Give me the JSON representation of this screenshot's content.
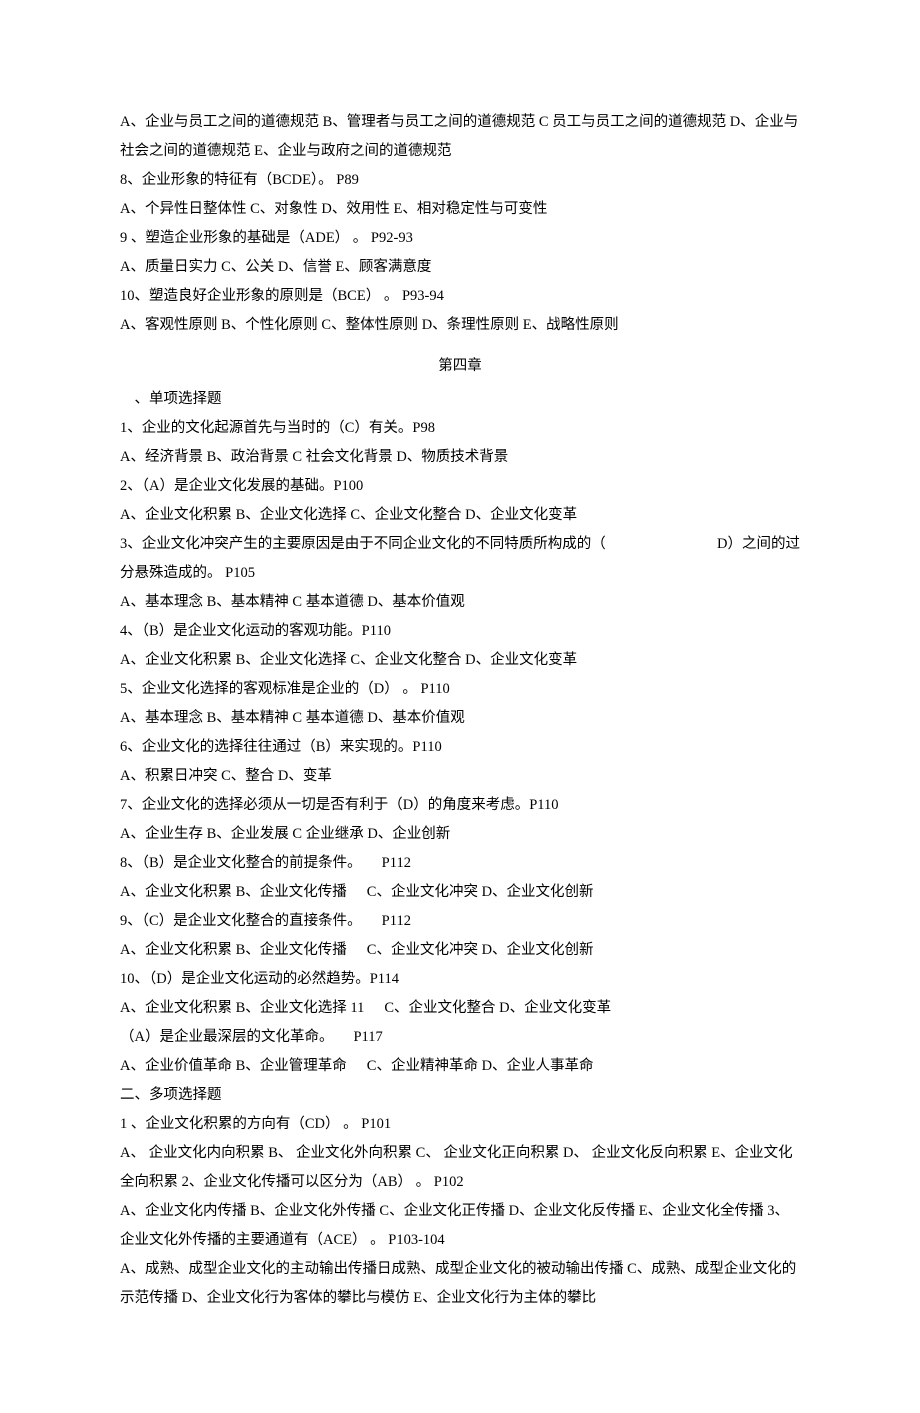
{
  "block1": {
    "l1": "A、企业与员工之间的道德规范 B、管理者与员工之间的道德规范 C 员工与员工之间的道德规范 D、企业与社会之间的道德规范 E、企业与政府之间的道德规范",
    "l2": "8、企业形象的特征有（BCDE）。 P89",
    "l3": "A、个异性日整体性 C、对象性 D、效用性 E、相对稳定性与可变性",
    "l4": "9 、塑造企业形象的基础是（ADE） 。 P92-93",
    "l5": "A、质量日实力 C、公关 D、信誉 E、顾客满意度",
    "l6": "10、塑造良好企业形象的原则是（BCE） 。 P93-94",
    "l7": "A、客观性原则 B、个性化原则 C、整体性原则 D、条理性原则 E、战略性原则"
  },
  "chapter4": "第四章",
  "sec1_title": "、单项选择题",
  "sec1": {
    "q1": "1、企业的文化起源首先与当时的（C）有关。P98",
    "q1a": "A、经济背景 B、政治背景 C 社会文化背景 D、物质技术背景",
    "q2": "2、（A）是企业文化发展的基础。P100",
    "q2a": "A、企业文化积累 B、企业文化选择 C、企业文化整合 D、企业文化变革",
    "q3a": "3、企业文化冲突产生的主要原因是由于不同企业文化的不同特质所构成的（",
    "q3b": "D）之间的过",
    "q3c": "分悬殊造成的。 P105",
    "q3d": "A、基本理念 B、基本精神 C 基本道德 D、基本价值观",
    "q4": "4、（B）是企业文化运动的客观功能。P110",
    "q4a": "A、企业文化积累 B、企业文化选择 C、企业文化整合 D、企业文化变革",
    "q5": "5、企业文化选择的客观标准是企业的（D） 。 P110",
    "q5a": "A、基本理念 B、基本精神 C 基本道德 D、基本价值观",
    "q6": "6、企业文化的选择往往通过（B）来实现的。P110",
    "q6a": "A、积累日冲突 C、整合 D、变革",
    "q7": "7、企业文化的选择必须从一切是否有利于（D）的角度来考虑。P110",
    "q7a": "A、企业生存 B、企业发展 C 企业继承 D、企业创新",
    "q8l": "8、（B）是企业文化整合的前提条件。",
    "q8r": "P112",
    "q8a_l": "A、企业文化积累 B、企业文化传播",
    "q8a_r": "C、企业文化冲突  D、企业文化创新",
    "q9l": "9、（C）是企业文化整合的直接条件。",
    "q9r": "P112",
    "q9a_l": "A、企业文化积累 B、企业文化传播",
    "q9a_r": "C、企业文化冲突  D、企业文化创新",
    "q10": "10、（D）是企业文化运动的必然趋势。P114",
    "q10a_l": "A、企业文化积累 B、企业文化选择 11",
    "q10a_r": "C、企业文化整合 D、企业文化变革",
    "q11l": "（A）是企业最深层的文化革命。",
    "q11r": "P117",
    "q11a_l": "A、企业价值革命 B、企业管理革命",
    "q11a_r": "C、企业精神革命 D、企业人事革命"
  },
  "sec2_title": "二、多项选择题",
  "sec2": {
    "q1": "1 、企业文化积累的方向有（CD） 。 P101",
    "q1a": "A、 企业文化内向积累 B、 企业文化外向积累 C、 企业文化正向积累 D、 企业文化反向积累 E、企业文化全向积累 2、企业文化传播可以区分为（AB） 。 P102",
    "q2a": "A、企业文化内传播 B、企业文化外传播 C、企业文化正传播 D、企业文化反传播 E、企业文化全传播 3、企业文化外传播的主要通道有（ACE） 。 P103-104",
    "q3a": "A、成熟、成型企业文化的主动输出传播日成熟、成型企业文化的被动输出传播 C、成熟、成型企业文化的示范传播 D、企业文化行为客体的攀比与模仿 E、企业文化行为主体的攀比"
  }
}
